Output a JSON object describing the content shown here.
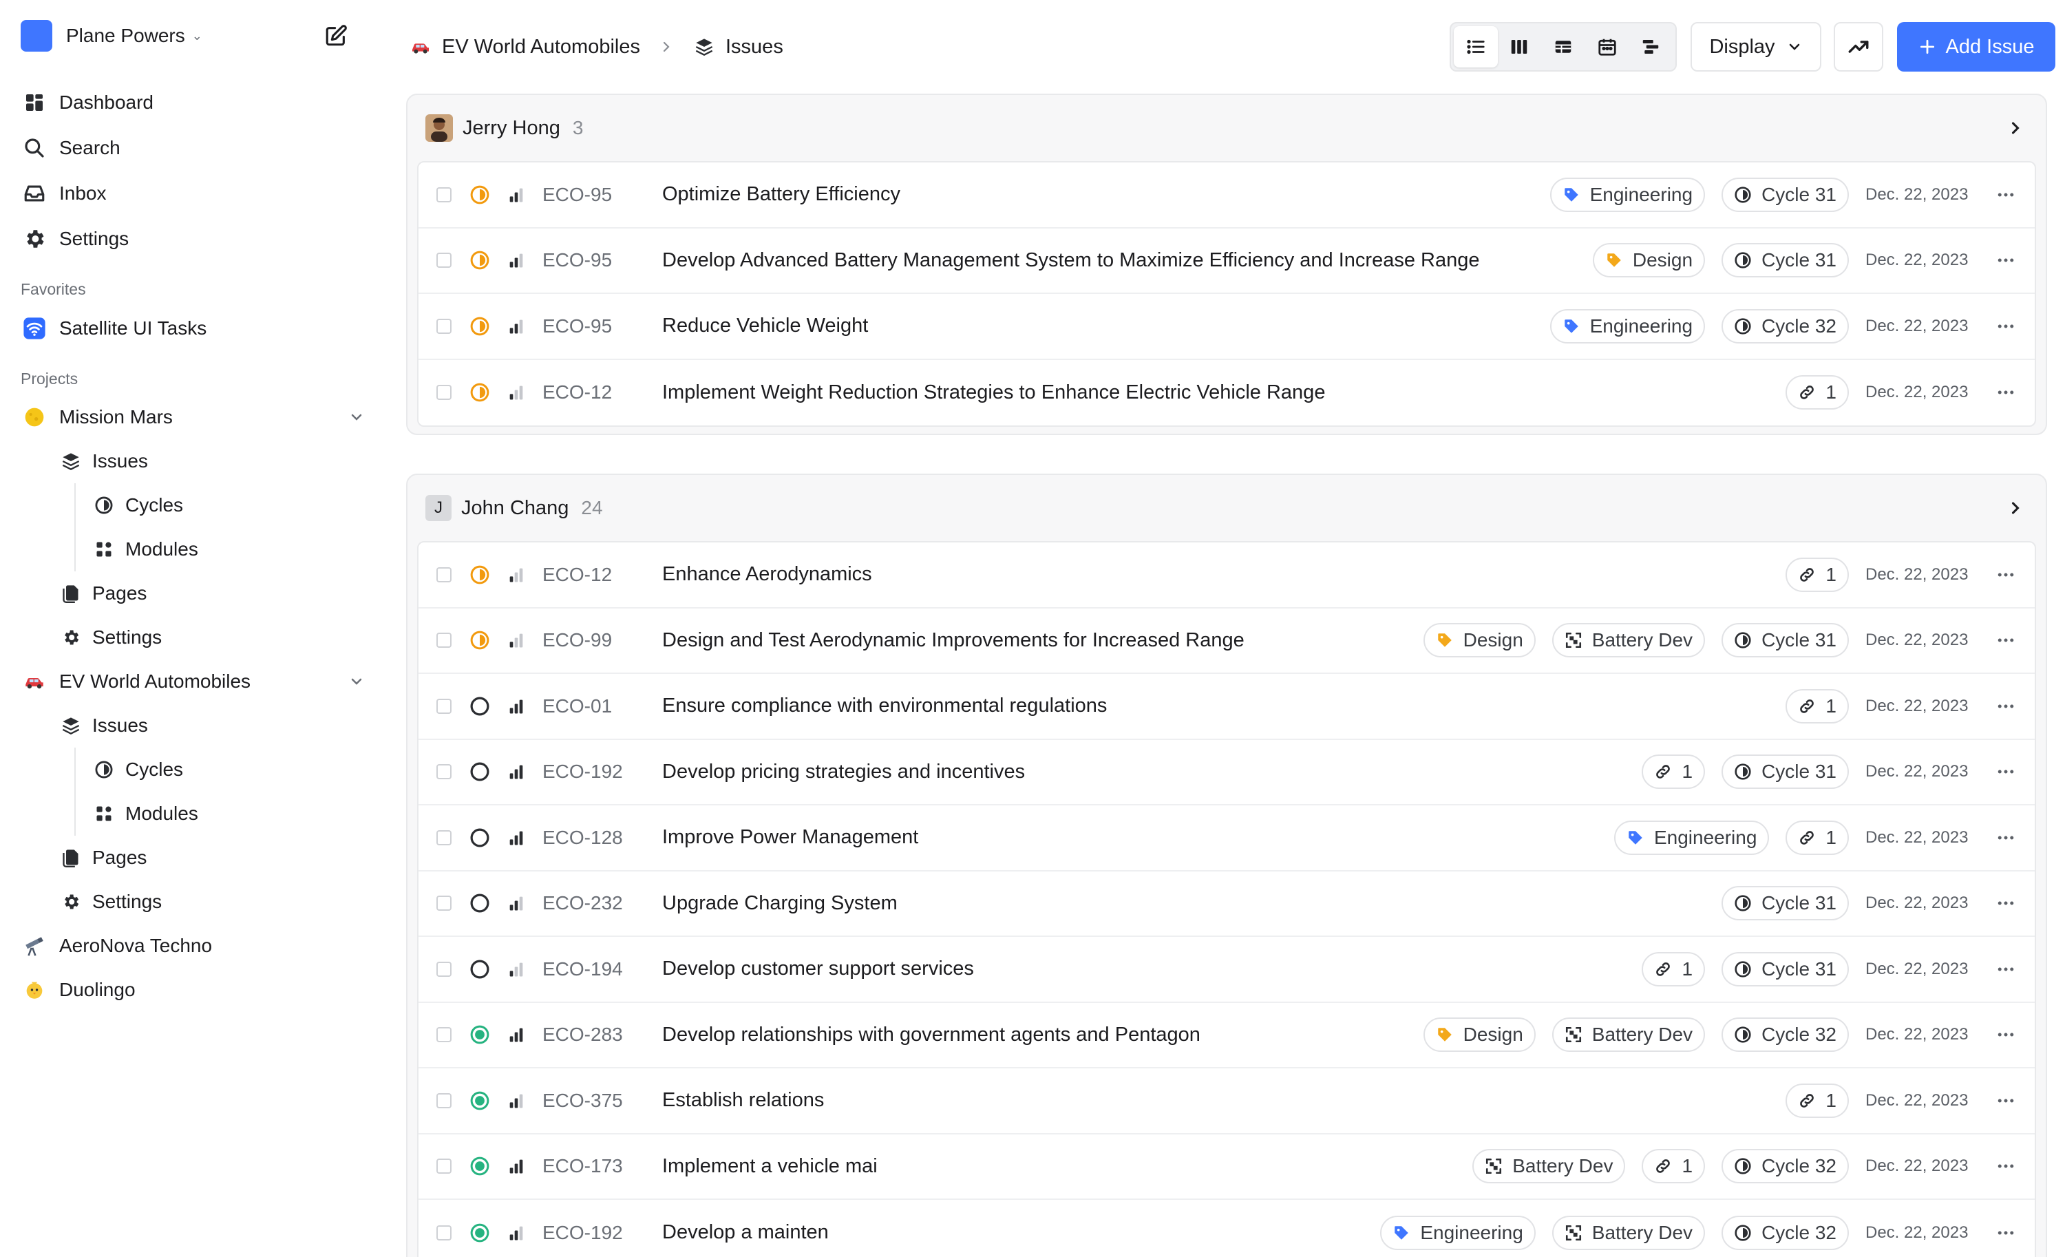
{
  "workspace": {
    "name": "Plane Powers"
  },
  "nav": [
    {
      "key": "dashboard",
      "label": "Dashboard"
    },
    {
      "key": "search",
      "label": "Search"
    },
    {
      "key": "inbox",
      "label": "Inbox"
    },
    {
      "key": "settings",
      "label": "Settings"
    }
  ],
  "favorites": {
    "heading": "Favorites",
    "items": [
      {
        "label": "Satellite UI Tasks"
      }
    ]
  },
  "projects": {
    "heading": "Projects",
    "mission_mars": {
      "label": "Mission Mars",
      "issues": "Issues",
      "cycles": "Cycles",
      "modules": "Modules",
      "pages": "Pages",
      "settings": "Settings"
    },
    "ev_world": {
      "label": "EV World Automobiles",
      "issues": "Issues",
      "cycles": "Cycles",
      "modules": "Modules",
      "pages": "Pages",
      "settings": "Settings"
    },
    "aeronova": {
      "label": "AeroNova Techno"
    },
    "duolingo": {
      "label": "Duolingo"
    }
  },
  "breadcrumb": {
    "project": "EV World Automobiles",
    "page": "Issues"
  },
  "toolbar": {
    "display_label": "Display",
    "add_label": "Add Issue"
  },
  "colors": {
    "accent": "#3f76ff",
    "in_progress": "#f29a0e",
    "done": "#26b380",
    "design_label": "#f3a81a",
    "engineering_label": "#3f76ff"
  },
  "groups": [
    {
      "name": "Jerry Hong",
      "count": "3",
      "avatar": "photo",
      "issues": [
        {
          "id": "ECO-95",
          "state": "in_progress",
          "priority": "high",
          "title": "Optimize Battery Efficiency",
          "props": [
            {
              "type": "label",
              "color": "blue",
              "text": "Engineering"
            },
            {
              "type": "cycle",
              "text": "Cycle 31"
            }
          ],
          "date": "Dec. 22, 2023"
        },
        {
          "id": "ECO-95",
          "state": "in_progress",
          "priority": "high",
          "title": "Develop Advanced Battery Management System to Maximize Efficiency and Increase Range",
          "props": [
            {
              "type": "label",
              "color": "orange",
              "text": "Design"
            },
            {
              "type": "cycle",
              "text": "Cycle 31"
            }
          ],
          "date": "Dec. 22, 2023"
        },
        {
          "id": "ECO-95",
          "state": "in_progress",
          "priority": "high",
          "title": "Reduce Vehicle Weight",
          "props": [
            {
              "type": "label",
              "color": "blue",
              "text": "Engineering"
            },
            {
              "type": "cycle",
              "text": "Cycle 32"
            }
          ],
          "date": "Dec. 22, 2023"
        },
        {
          "id": "ECO-12",
          "state": "in_progress",
          "priority": "low",
          "title": "Implement Weight Reduction Strategies to Enhance Electric Vehicle Range",
          "props": [
            {
              "type": "link",
              "text": "1"
            }
          ],
          "date": "Dec. 22, 2023"
        }
      ]
    },
    {
      "name": "John Chang",
      "count": "24",
      "avatar": "J",
      "issues": [
        {
          "id": "ECO-12",
          "state": "in_progress",
          "priority": "low",
          "title": "Enhance Aerodynamics",
          "props": [
            {
              "type": "link",
              "text": "1"
            }
          ],
          "date": "Dec. 22, 2023"
        },
        {
          "id": "ECO-99",
          "state": "in_progress",
          "priority": "low",
          "title": "Design and Test Aerodynamic Improvements for Increased Range",
          "props": [
            {
              "type": "label",
              "color": "orange",
              "text": "Design"
            },
            {
              "type": "module",
              "text": "Battery Dev"
            },
            {
              "type": "cycle",
              "text": "Cycle 31"
            }
          ],
          "date": "Dec. 22, 2023"
        },
        {
          "id": "ECO-01",
          "state": "todo",
          "priority": "urgent",
          "title": "Ensure compliance with environmental regulations",
          "props": [
            {
              "type": "link",
              "text": "1"
            }
          ],
          "date": "Dec. 22, 2023"
        },
        {
          "id": "ECO-192",
          "state": "todo",
          "priority": "urgent",
          "title": "Develop pricing strategies and incentives",
          "props": [
            {
              "type": "link",
              "text": "1"
            },
            {
              "type": "cycle",
              "text": "Cycle 31"
            }
          ],
          "date": "Dec. 22, 2023"
        },
        {
          "id": "ECO-128",
          "state": "todo",
          "priority": "urgent",
          "title": "Improve Power Management",
          "props": [
            {
              "type": "label",
              "color": "blue",
              "text": "Engineering"
            },
            {
              "type": "link",
              "text": "1"
            }
          ],
          "date": "Dec. 22, 2023"
        },
        {
          "id": "ECO-232",
          "state": "todo",
          "priority": "medium",
          "title": "Upgrade Charging System",
          "props": [
            {
              "type": "cycle",
              "text": "Cycle 31"
            }
          ],
          "date": "Dec. 22, 2023"
        },
        {
          "id": "ECO-194",
          "state": "todo",
          "priority": "low",
          "title": "Develop customer support services",
          "props": [
            {
              "type": "link",
              "text": "1"
            },
            {
              "type": "cycle",
              "text": "Cycle 31"
            }
          ],
          "date": "Dec. 22, 2023"
        },
        {
          "id": "ECO-283",
          "state": "done",
          "priority": "urgent",
          "title": "Develop relationships with government agents and Pentagon",
          "props": [
            {
              "type": "label",
              "color": "orange",
              "text": "Design"
            },
            {
              "type": "module",
              "text": "Battery Dev"
            },
            {
              "type": "cycle",
              "text": "Cycle 32"
            }
          ],
          "date": "Dec. 22, 2023"
        },
        {
          "id": "ECO-375",
          "state": "done",
          "priority": "medium",
          "title": "Establish relations",
          "props": [
            {
              "type": "link",
              "text": "1"
            }
          ],
          "date": "Dec. 22, 2023"
        },
        {
          "id": "ECO-173",
          "state": "done",
          "priority": "urgent",
          "title": "Implement a vehicle mai",
          "props": [
            {
              "type": "module",
              "text": "Battery Dev"
            },
            {
              "type": "link",
              "text": "1"
            },
            {
              "type": "cycle",
              "text": "Cycle 32"
            }
          ],
          "date": "Dec. 22, 2023"
        },
        {
          "id": "ECO-192",
          "state": "done",
          "priority": "medium",
          "title": "Develop a mainten",
          "props": [
            {
              "type": "label",
              "color": "blue",
              "text": "Engineering"
            },
            {
              "type": "module",
              "text": "Battery Dev"
            },
            {
              "type": "cycle",
              "text": "Cycle 32"
            }
          ],
          "date": "Dec. 22, 2023"
        }
      ]
    }
  ]
}
